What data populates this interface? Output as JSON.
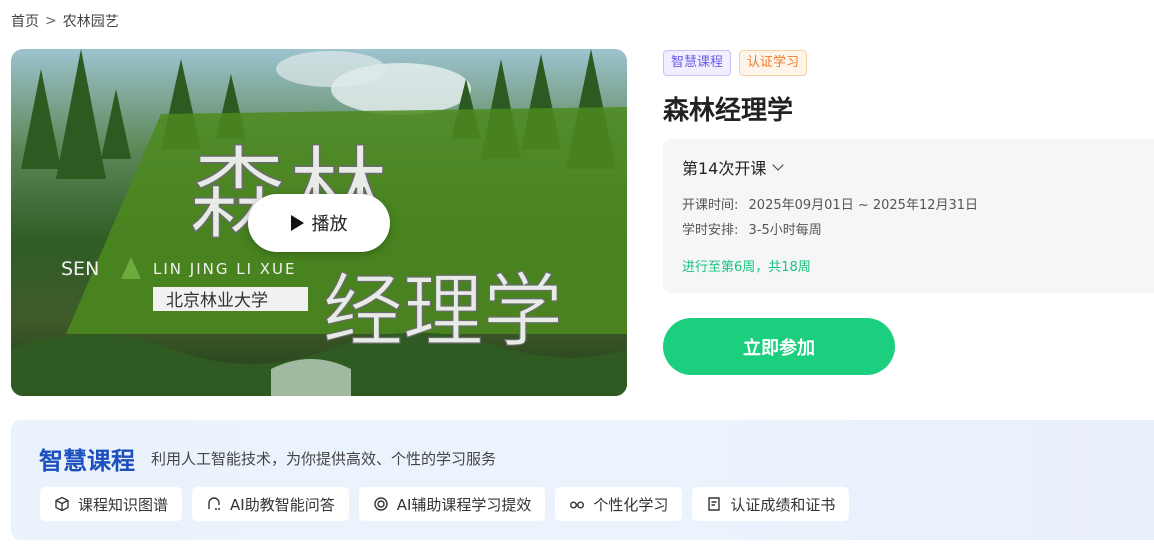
{
  "breadcrumb": {
    "home": "首页",
    "separator": ">",
    "current": "农林园艺"
  },
  "cover": {
    "title_big": "森林",
    "title_big2": "经理学",
    "pinyin_left": "SEN",
    "pinyin_right": "LIN JING LI XUE",
    "university": "北京林业大学",
    "play_label": "播放"
  },
  "tags": [
    {
      "label": "智慧课程",
      "color": "#6c5ce7"
    },
    {
      "label": "认证学习",
      "color": "#ef7b2a"
    }
  ],
  "course": {
    "title": "森林经理学",
    "session": "第14次开课",
    "time_label": "开课时间:",
    "time_value": "2025年09月01日 ~ 2025年12月31日",
    "hours_label": "学时安排:",
    "hours_value": "3-5小时每周",
    "progress_text": "进行至第6周，共18周",
    "join_label": "立即参加"
  },
  "smart": {
    "title": "智慧课程",
    "description": "利用人工智能技术，为你提供高效、个性的学习服务",
    "features": [
      {
        "label": "课程知识图谱",
        "icon": "cube-icon"
      },
      {
        "label": "AI助教智能问答",
        "icon": "ai-qa-icon"
      },
      {
        "label": "AI辅助课程学习提效",
        "icon": "ai-ring-icon"
      },
      {
        "label": "个性化学习",
        "icon": "glasses-icon"
      },
      {
        "label": "认证成绩和证书",
        "icon": "certificate-icon"
      }
    ]
  },
  "colors": {
    "accent_green": "#1ccf7e",
    "brand_blue": "#1d4fbf",
    "progress_green": "#19c37d"
  }
}
